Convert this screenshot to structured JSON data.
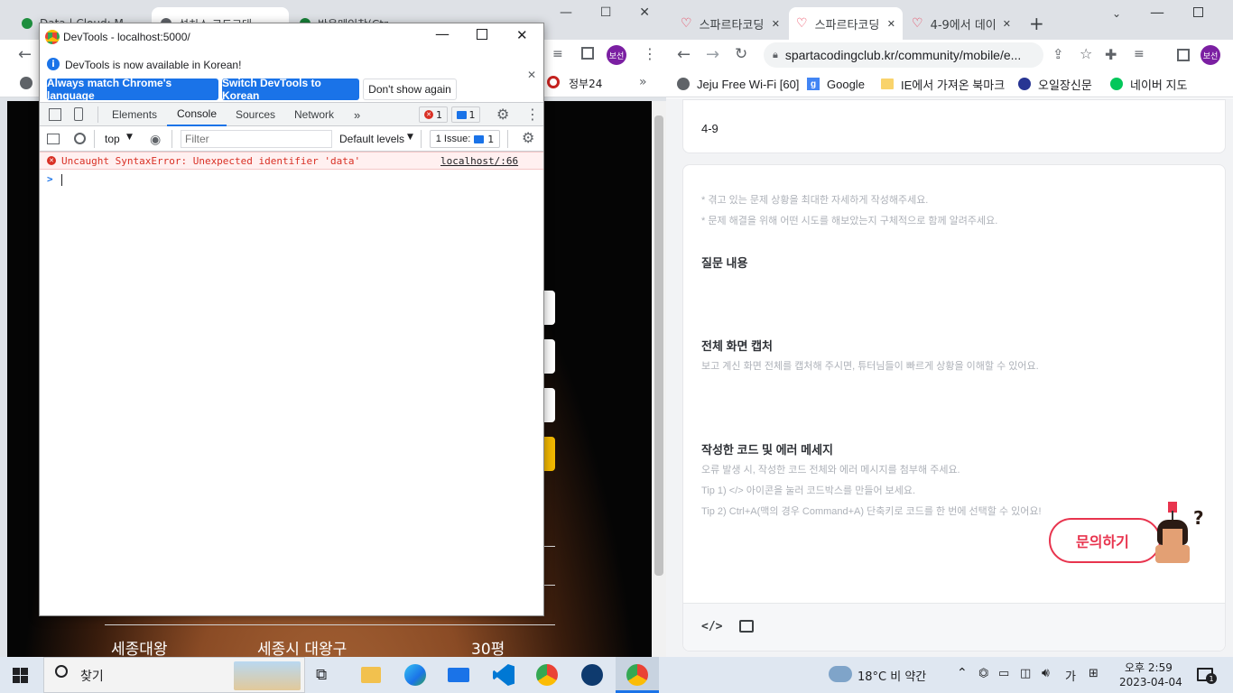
{
  "left_browser": {
    "tabs": [
      "Data | Cloud: M",
      "설치소 코드그대",
      "반응메인창(Ctr"
    ],
    "bookmark_overflow": "정부24",
    "profile_badge": "보선",
    "page_rows": {
      "col1": "세종대왕",
      "col2": "세종시 대왕구",
      "col3": "30평"
    }
  },
  "devtools": {
    "title": "DevTools - localhost:5000/",
    "banner_text": "DevTools is now available in Korean!",
    "btn_match": "Always match Chrome's language",
    "btn_switch": "Switch DevTools to Korean",
    "btn_dont_show": "Don't show again",
    "tabs": [
      "Elements",
      "Console",
      "Sources",
      "Network"
    ],
    "more_tabs": "»",
    "error_count": "1",
    "message_count": "1",
    "context": "top",
    "filter_placeholder": "Filter",
    "levels": "Default levels",
    "issues_label": "1 Issue:",
    "issues_count": "1",
    "error_message": "Uncaught SyntaxError: Unexpected identifier 'data'",
    "error_source": "localhost/:66",
    "prompt": ">"
  },
  "right_browser": {
    "tabs": [
      "스파르타코딩",
      "스파르타코딩",
      "4-9에서 데이"
    ],
    "url": "spartacodingclub.kr/community/mobile/e...",
    "profile_badge": "보선",
    "bookmarks": [
      "Jeju Free Wi-Fi [60]",
      "Google",
      "IE에서 가져온 북마크",
      "오일장신문",
      "네이버 지도"
    ],
    "title_field": "4-9",
    "hint1": "* 겪고 있는 문제 상황을 최대한 자세하게 작성해주세요.",
    "hint2": "* 문제 해결을 위해 어떤 시도를 해보았는지 구체적으로 함께 알려주세요.",
    "section1_title": "질문 내용",
    "section2_title": "전체 화면 캡처",
    "section2_hint": "보고 계신 화면 전체를 캡처해 주시면, 튜터님들이 빠르게 상황을 이해할 수 있어요.",
    "section3_title": "작성한 코드 및 에러 메세지",
    "section3_hint1": "오류 발생 시, 작성한 코드 전체와 에러 메시지를 첨부해 주세요.",
    "section3_hint2": "Tip 1) </> 아이콘을 눌러 코드박스를 만들어 보세요.",
    "section3_hint3": "Tip 2) Ctrl+A(맥의 경우 Command+A) 단축키로 코드를 한 번에 선택할 수 있어요!",
    "inquiry_button": "문의하기",
    "code_icon_label": "</>"
  },
  "taskbar": {
    "search_label": "찾기",
    "weather": "18°C  비 약간",
    "ime": "가",
    "time": "오후 2:59",
    "date": "2023-04-04",
    "notification_count": "1"
  },
  "colors": {
    "accent_blue": "#1a73e8",
    "error_red": "#d93025",
    "sparta_red": "#e8344e",
    "profile_purple": "#7b1fa2"
  }
}
